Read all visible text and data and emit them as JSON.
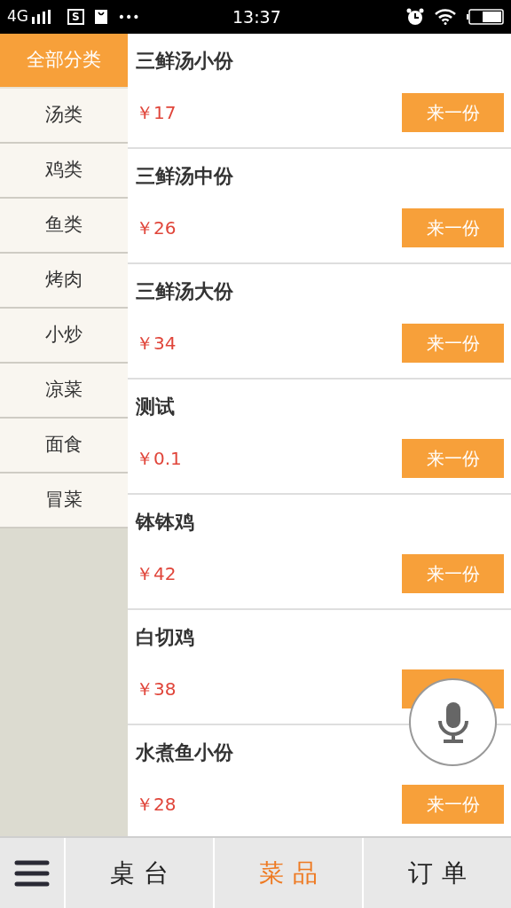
{
  "status_bar": {
    "network": "4G",
    "notice_letter": "S",
    "more": "•••",
    "time": "13:37"
  },
  "categories": [
    {
      "label": "全部分类",
      "selected": true
    },
    {
      "label": "汤类",
      "selected": false
    },
    {
      "label": "鸡类",
      "selected": false
    },
    {
      "label": "鱼类",
      "selected": false
    },
    {
      "label": "烤肉",
      "selected": false
    },
    {
      "label": "小炒",
      "selected": false
    },
    {
      "label": "凉菜",
      "selected": false
    },
    {
      "label": "面食",
      "selected": false
    },
    {
      "label": "冒菜",
      "selected": false
    }
  ],
  "dishes": [
    {
      "name": "三鲜汤小份",
      "price": "￥17",
      "button": "来一份"
    },
    {
      "name": "三鲜汤中份",
      "price": "￥26",
      "button": "来一份"
    },
    {
      "name": "三鲜汤大份",
      "price": "￥34",
      "button": "来一份"
    },
    {
      "name": "测试",
      "price": "￥0.1",
      "button": "来一份"
    },
    {
      "name": "钵钵鸡",
      "price": "￥42",
      "button": "来一份"
    },
    {
      "name": "白切鸡",
      "price": "￥38"
    },
    {
      "name": "水煮鱼小份",
      "price": "￥28",
      "button": "来一份"
    }
  ],
  "bottom_nav": [
    {
      "label": "桌台",
      "selected": false
    },
    {
      "label": "菜品",
      "selected": true
    },
    {
      "label": "订单",
      "selected": false
    }
  ]
}
